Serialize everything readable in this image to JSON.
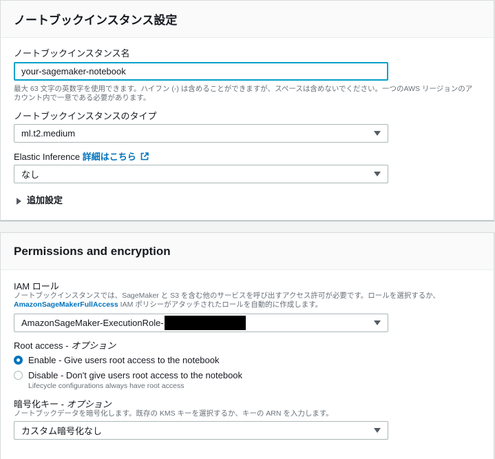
{
  "section1": {
    "title": "ノートブックインスタンス設定",
    "name_label": "ノートブックインスタンス名",
    "name_value": "your-sagemaker-notebook",
    "name_help_1": "最大 63 文字の英数字を使用できます。ハイフン (-) は含めることができますが、スペースは含めないでください。一つのAWS リージョンのア",
    "name_help_2": "カウント内で一意である必要があります。",
    "type_label": "ノートブックインスタンスのタイプ",
    "type_value": "ml.t2.medium",
    "ei_label": "Elastic Inference",
    "ei_link": "詳細はこちら",
    "ei_value": "なし",
    "additional": "追加設定"
  },
  "section2": {
    "title": "Permissions and encryption",
    "iam_label": "IAM ロール",
    "iam_help_1": "ノートブックインスタンスでは、SageMaker と S3 を含む他のサービスを呼び出すアクセス許可が必要です。ロールを選択するか、",
    "iam_help_link": "AmazonSageMakerFullAccess",
    "iam_help_2": " IAM ポリシーがアタッチされたロールを自動的に作成します。",
    "iam_value": "AmazonSageMaker-ExecutionRole-",
    "root_label": "Root access - ",
    "root_optional": "オプション",
    "enable_label": "Enable - Give users root access to the notebook",
    "disable_label": "Disable - Don't give users root access to the notebook",
    "disable_sub": "Lifecycle configurations always have root access",
    "enc_label": "暗号化キー - ",
    "enc_optional": "オプション",
    "enc_help": "ノートブックデータを暗号化します。既存の KMS キーを選択するか、キーの ARN を入力します。",
    "enc_value": "カスタム暗号化なし"
  },
  "colors": {
    "accent": "#0073bb",
    "focus_border": "#00a1c9",
    "background": "#f2f3f3"
  },
  "icons": {
    "external_link": "external-link-icon",
    "dropdown": "caret-down-icon",
    "expand": "caret-right-icon"
  }
}
